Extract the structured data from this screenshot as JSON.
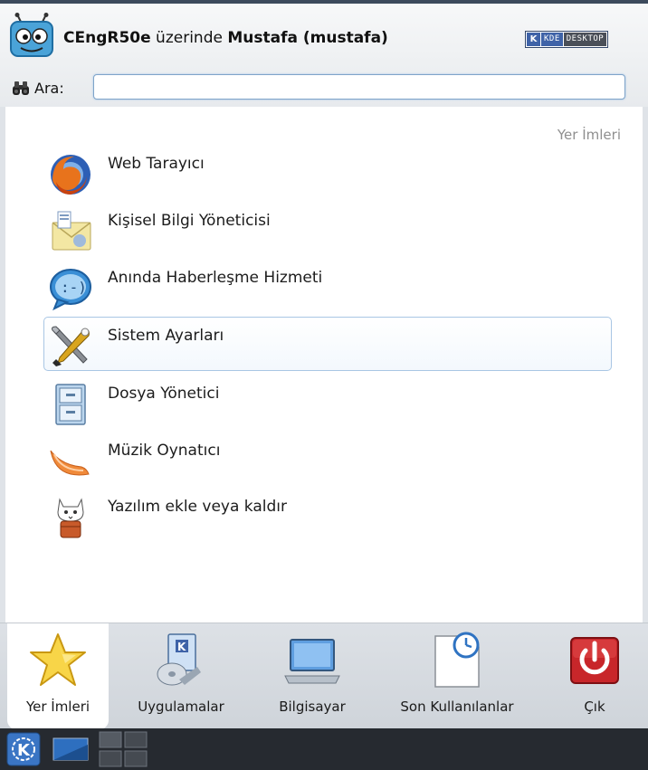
{
  "header": {
    "host": "CEngR50e",
    "connector": "üzerinde",
    "user": "Mustafa (mustafa)",
    "badge_k": "K",
    "badge_text1": "KDE",
    "badge_text2": "DESKTOP"
  },
  "search": {
    "label": "Ara:",
    "value": "",
    "placeholder": ""
  },
  "main": {
    "section_title": "Yer İmleri",
    "items": [
      {
        "label": "Web Tarayıcı",
        "icon": "firefox-icon"
      },
      {
        "label": "Kişisel Bilgi Yöneticisi",
        "icon": "pim-icon"
      },
      {
        "label": "Anında Haberleşme Hizmeti",
        "icon": "chat-icon"
      },
      {
        "label": "Sistem Ayarları",
        "icon": "system-settings-icon"
      },
      {
        "label": "Dosya Yönetici",
        "icon": "file-manager-icon"
      },
      {
        "label": "Müzik Oynatıcı",
        "icon": "music-player-icon"
      },
      {
        "label": "Yazılım ekle veya kaldır",
        "icon": "software-manager-icon"
      }
    ]
  },
  "tabs": [
    {
      "label": "Yer İmleri",
      "icon": "star-icon",
      "active": true
    },
    {
      "label": "Uygulamalar",
      "icon": "applications-icon",
      "active": false
    },
    {
      "label": "Bilgisayar",
      "icon": "computer-icon",
      "active": false
    },
    {
      "label": "Son Kullanılanlar",
      "icon": "recent-icon",
      "active": false
    },
    {
      "label": "Çık",
      "icon": "power-icon",
      "active": false
    }
  ],
  "colors": {
    "accent": "#3f63a8",
    "hover_border": "#a9c6e4",
    "power_red": "#c8262a",
    "taskbar": "#262a30"
  }
}
